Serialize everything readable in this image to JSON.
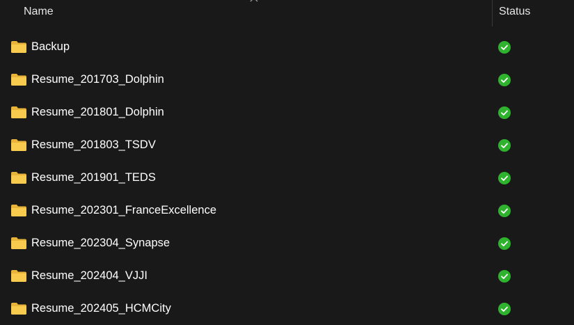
{
  "columns": {
    "name": "Name",
    "status": "Status"
  },
  "sort_indicator_icon": "chevron-up-icon",
  "folder_icon": "folder-icon",
  "status_icon": "synced-check-icon",
  "colors": {
    "background": "#191919",
    "folder": "#f5c542",
    "synced": "#2fb32f"
  },
  "items": [
    {
      "name": "Backup"
    },
    {
      "name": "Resume_201703_Dolphin"
    },
    {
      "name": "Resume_201801_Dolphin"
    },
    {
      "name": "Resume_201803_TSDV"
    },
    {
      "name": "Resume_201901_TEDS"
    },
    {
      "name": "Resume_202301_FranceExcellence"
    },
    {
      "name": "Resume_202304_Synapse"
    },
    {
      "name": "Resume_202404_VJJI"
    },
    {
      "name": "Resume_202405_HCMCity"
    }
  ]
}
